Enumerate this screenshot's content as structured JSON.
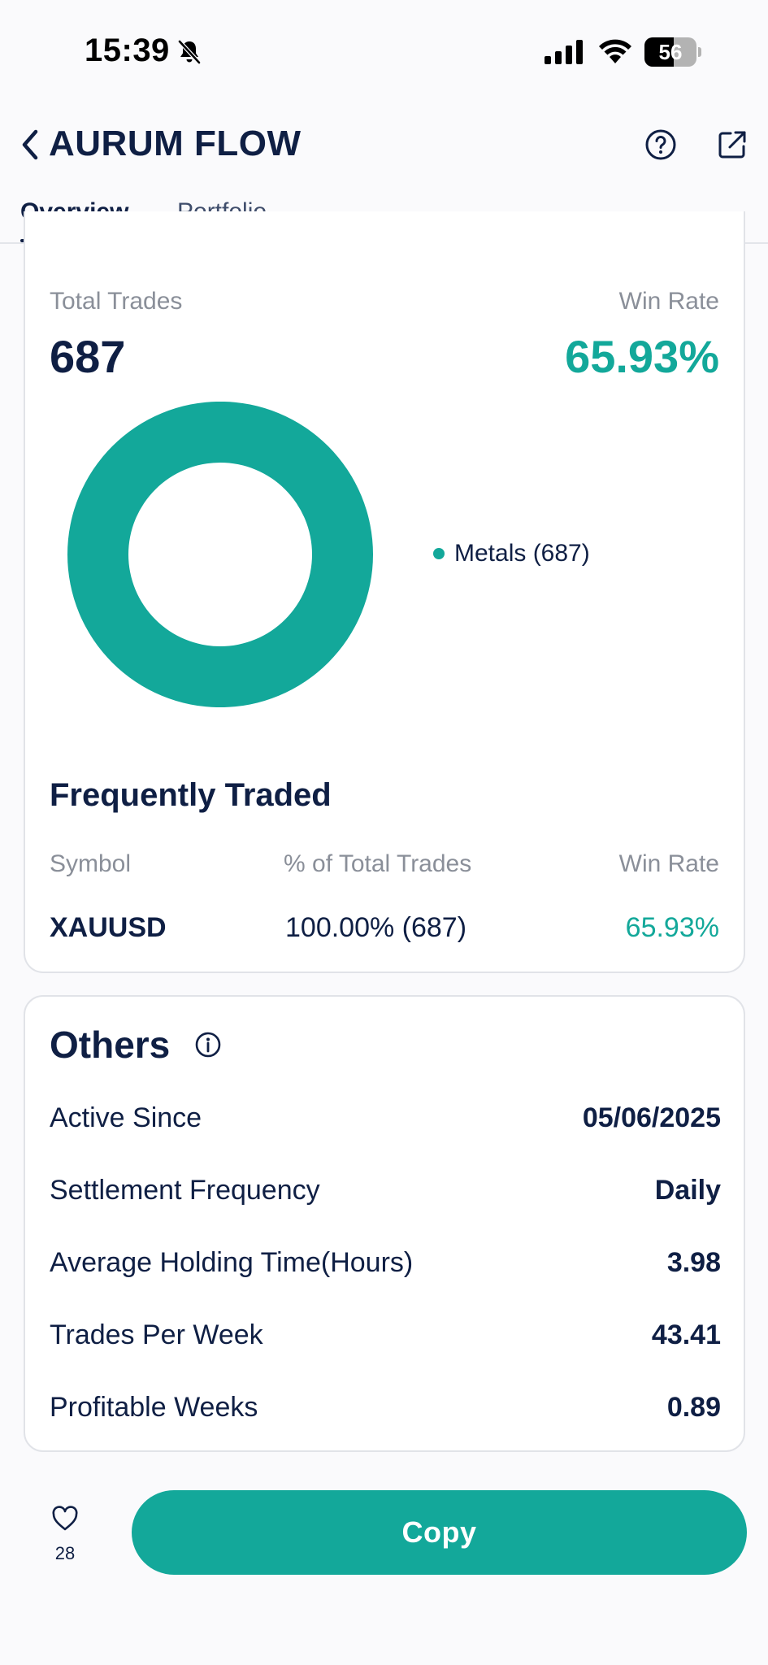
{
  "status_bar": {
    "time": "15:39",
    "battery_level": "56"
  },
  "header": {
    "title": "AURUM FLOW"
  },
  "tabs": [
    {
      "label": "Overview",
      "active": true
    },
    {
      "label": "Portfolio",
      "active": false
    }
  ],
  "stats": {
    "total_trades_label": "Total Trades",
    "total_trades_value": "687",
    "win_rate_label": "Win Rate",
    "win_rate_value": "65.93%"
  },
  "chart_data": {
    "type": "pie",
    "categories": [
      "Metals"
    ],
    "values": [
      687
    ],
    "legend": [
      "Metals (687)"
    ],
    "donut": true,
    "colors": [
      "#13a89a"
    ]
  },
  "frequently_traded": {
    "title": "Frequently Traded",
    "columns": [
      "Symbol",
      "% of Total Trades",
      "Win Rate"
    ],
    "rows": [
      {
        "symbol": "XAUUSD",
        "pct": "100.00% (687)",
        "win_rate": "65.93%"
      }
    ]
  },
  "others": {
    "title": "Others",
    "rows": [
      {
        "label": "Active Since",
        "value": "05/06/2025"
      },
      {
        "label": "Settlement Frequency",
        "value": "Daily"
      },
      {
        "label": "Average Holding Time(Hours)",
        "value": "3.98"
      },
      {
        "label": "Trades Per Week",
        "value": "43.41"
      },
      {
        "label": "Profitable Weeks",
        "value": "0.89"
      }
    ]
  },
  "bottom_bar": {
    "likes": "28",
    "copy_label": "Copy"
  },
  "colors": {
    "accent": "#13a89a",
    "text": "#0f1f44"
  },
  "icons": [
    "bell-slash-icon",
    "signal-icon",
    "wifi-icon",
    "battery-icon",
    "back-chevron-icon",
    "help-icon",
    "share-icon",
    "info-icon",
    "heart-icon"
  ]
}
